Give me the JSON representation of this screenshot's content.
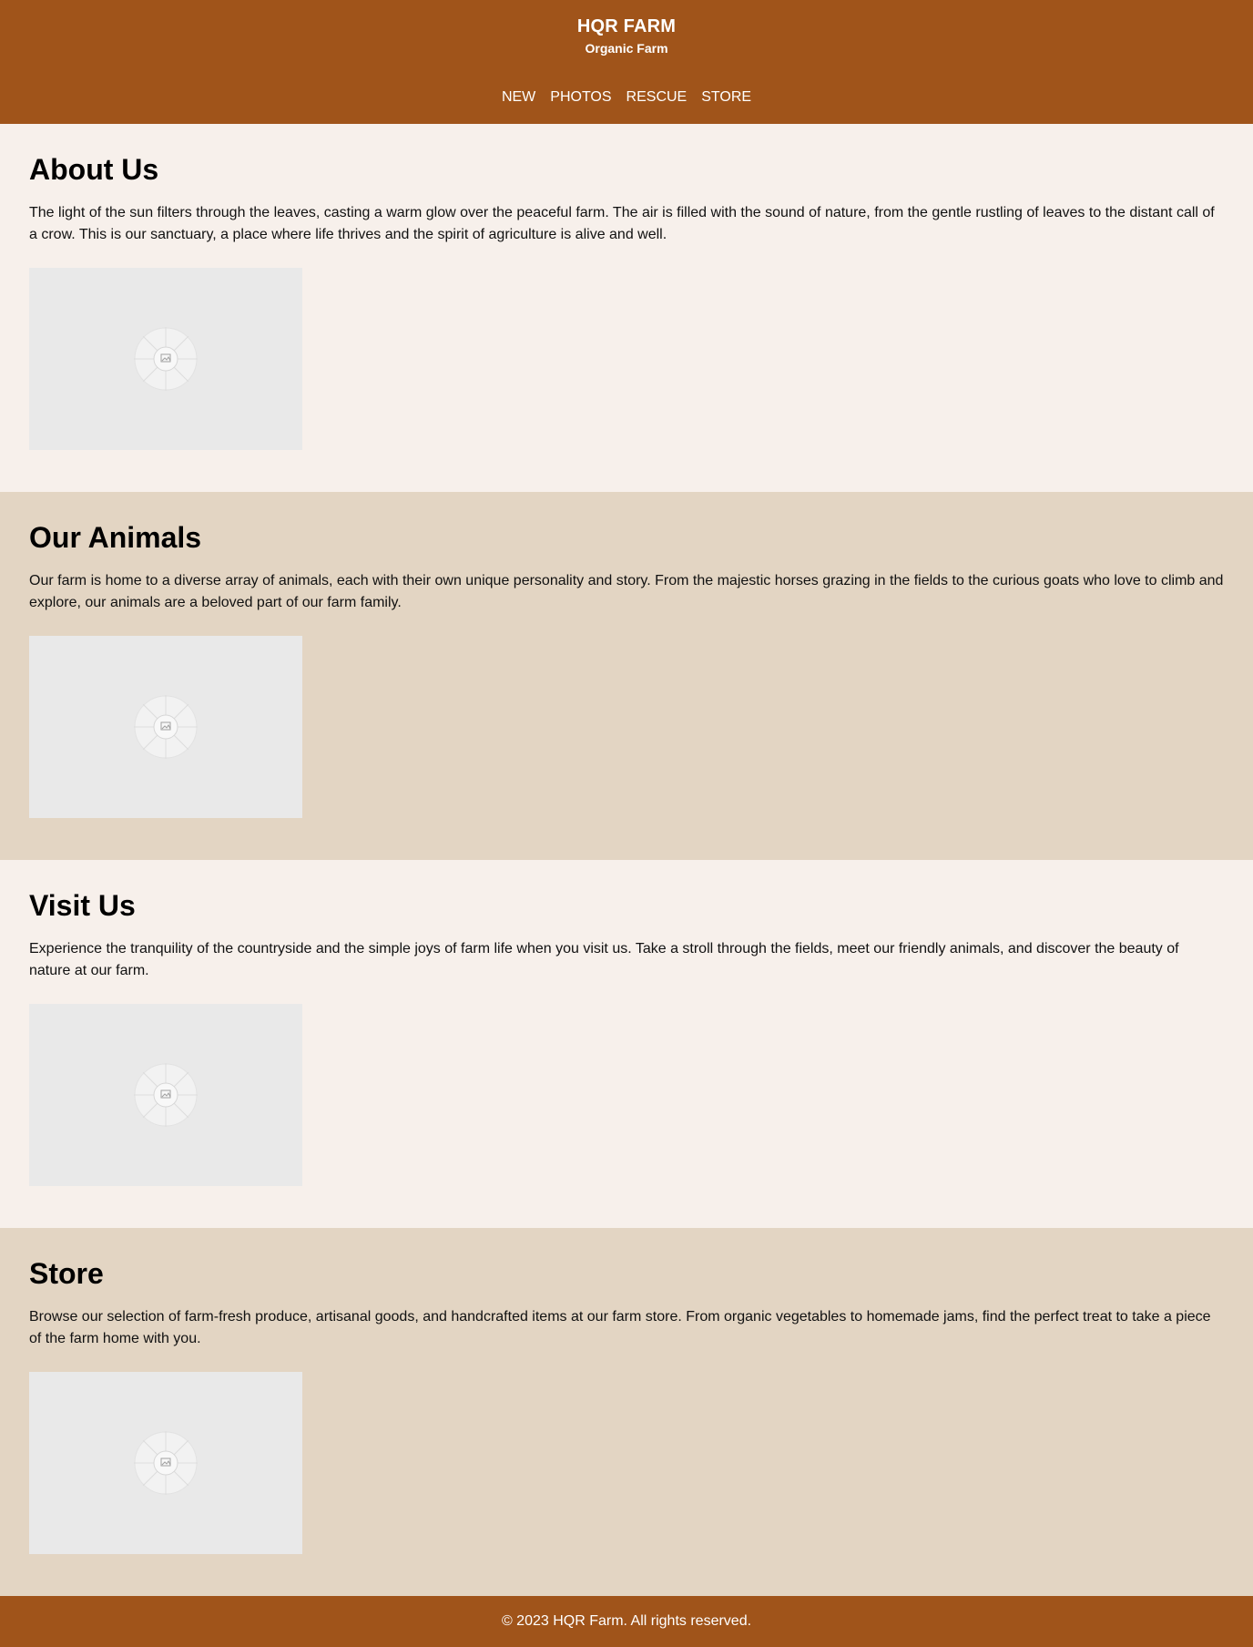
{
  "header": {
    "title": "HQR FARM",
    "subtitle": "Organic Farm",
    "nav": [
      "NEW",
      "PHOTOS",
      "RESCUE",
      "STORE"
    ]
  },
  "sections": [
    {
      "title": "About Us",
      "text": "The light of the sun filters through the leaves, casting a warm glow over the peaceful farm. The air is filled with the sound of nature, from the gentle rustling of leaves to the distant call of a crow. This is our sanctuary, a place where life thrives and the spirit of agriculture is alive and well."
    },
    {
      "title": "Our Animals",
      "text": "Our farm is home to a diverse array of animals, each with their own unique personality and story. From the majestic horses grazing in the fields to the curious goats who love to climb and explore, our animals are a beloved part of our farm family."
    },
    {
      "title": "Visit Us",
      "text": "Experience the tranquility of the countryside and the simple joys of farm life when you visit us. Take a stroll through the fields, meet our friendly animals, and discover the beauty of nature at our farm."
    },
    {
      "title": "Store",
      "text": "Browse our selection of farm-fresh produce, artisanal goods, and handcrafted items at our farm store. From organic vegetables to homemade jams, find the perfect treat to take a piece of the farm home with you."
    }
  ],
  "footer": {
    "text": "© 2023 HQR Farm. All rights reserved."
  },
  "icons": {
    "image_placeholder": "image-placeholder-icon"
  },
  "colors": {
    "header_bg": "#a0541a",
    "light_bg": "#f7f0eb",
    "tan_bg": "#e3d5c3"
  }
}
